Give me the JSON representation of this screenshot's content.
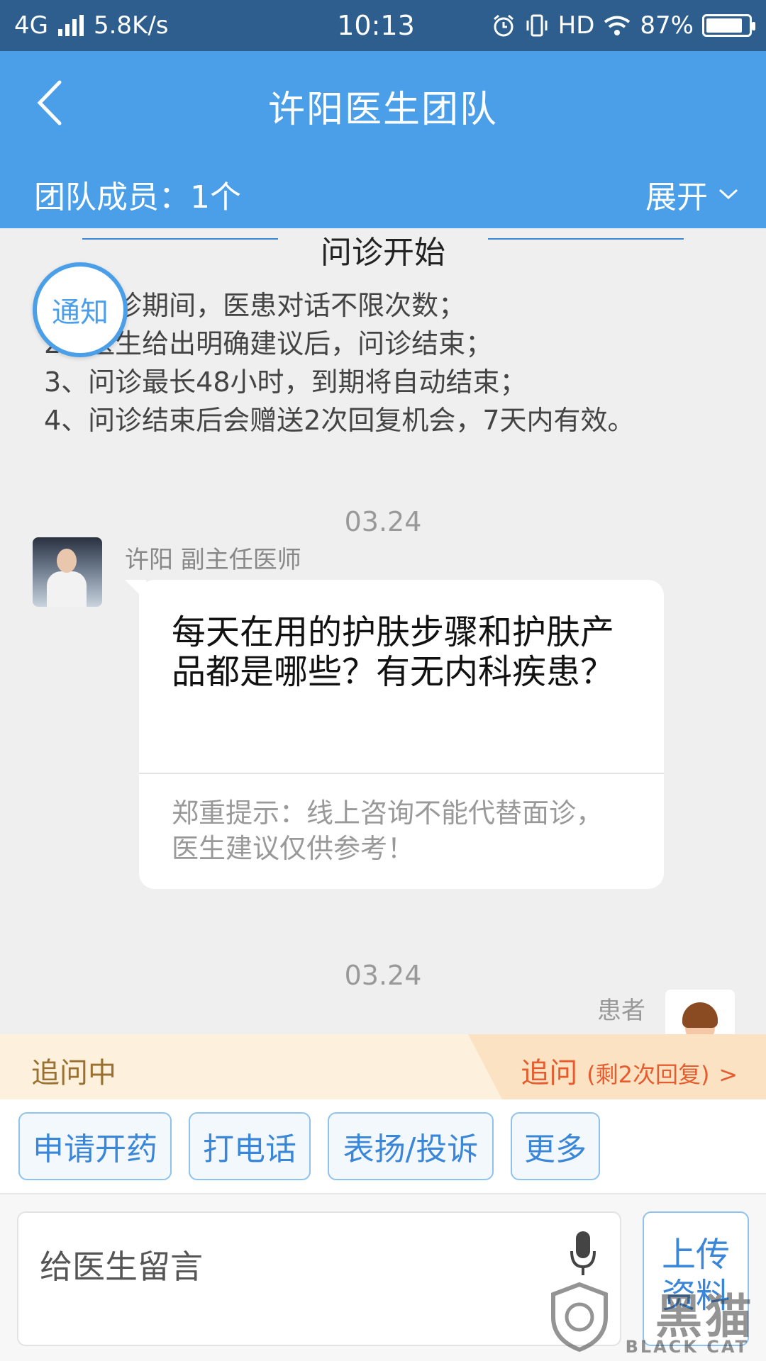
{
  "status_bar": {
    "network": "4G",
    "speed": "5.8K/s",
    "time": "10:13",
    "hd": "HD",
    "battery": "87%",
    "battery_level": 0.87
  },
  "header": {
    "title": "许阳医生团队",
    "members": "团队成员：1个",
    "expand": "展开"
  },
  "chat": {
    "section_title": "问诊开始",
    "notify_badge": "通知",
    "notice_lines": [
      "1、问诊期间，医患对话不限次数；",
      "2、医生给出明确建议后，问诊结束；",
      "3、问诊最长48小时，到期将自动结束；",
      "4、问诊结束后会赠送2次回复机会，7天内有效。"
    ],
    "date_1": "03.24",
    "doctor_name": "许阳 副主任医师",
    "doctor_message": "每天在用的护肤步骤和护肤产品都是哪些？有无内科疾患？",
    "disclaimer": "郑重提示：线上咨询不能代替面诊，医生建议仅供参考！",
    "date_2": "03.24",
    "patient_label": "患者"
  },
  "status_row": {
    "left": "追问中",
    "right_main": "追问",
    "right_detail": "(剩2次回复)",
    "right_arrow": ">"
  },
  "actions": [
    "申请开药",
    "打电话",
    "表扬/投诉",
    "更多"
  ],
  "input": {
    "placeholder": "给医生留言",
    "upload_line1": "上传",
    "upload_line2": "资料"
  },
  "watermark": {
    "big": "黑猫",
    "small": "BLACK CAT"
  },
  "colors": {
    "header": "#4a9fe8",
    "status_bar": "#2e5e8e",
    "accent": "#3a86d8",
    "followup": "#e65c2e"
  }
}
